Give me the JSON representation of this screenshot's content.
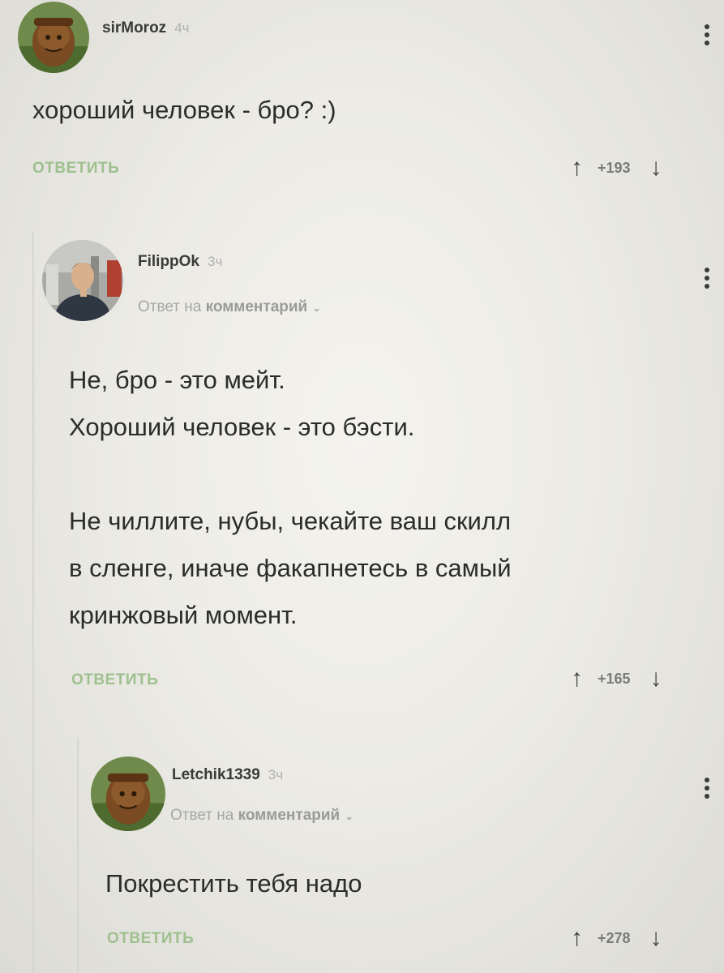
{
  "comments": [
    {
      "author": "sirMoroz",
      "time": "4ч",
      "text_lines": [
        "хороший человек - бро? :)"
      ],
      "reply_label": "ОТВЕТИТЬ",
      "score": "+193",
      "avatar_icon": "sack-avatar-icon"
    },
    {
      "author": "FilippOk",
      "time": "3ч",
      "reply_to_prefix": "Ответ на",
      "reply_to_link": "комментарий",
      "text_lines": [
        "Не, бро - это мейт.",
        "Хороший человек - это бэсти.",
        "",
        "Не чиллите, нубы, чекайте ваш скилл",
        "в сленге, иначе факапнетесь в самый",
        "кринжовый момент."
      ],
      "reply_label": "ОТВЕТИТЬ",
      "score": "+165",
      "avatar_icon": "person-photo-avatar-icon"
    },
    {
      "author": "Letchik1339",
      "time": "3ч",
      "reply_to_prefix": "Ответ на",
      "reply_to_link": "комментарий",
      "text_lines": [
        "Покрестить тебя надо"
      ],
      "reply_label": "ОТВЕТИТЬ",
      "score": "+278",
      "avatar_icon": "sack-avatar-icon"
    }
  ],
  "colors": {
    "reply_green": "#9ec08f",
    "text": "#2b2b2b",
    "muted": "#a6a6a6"
  }
}
